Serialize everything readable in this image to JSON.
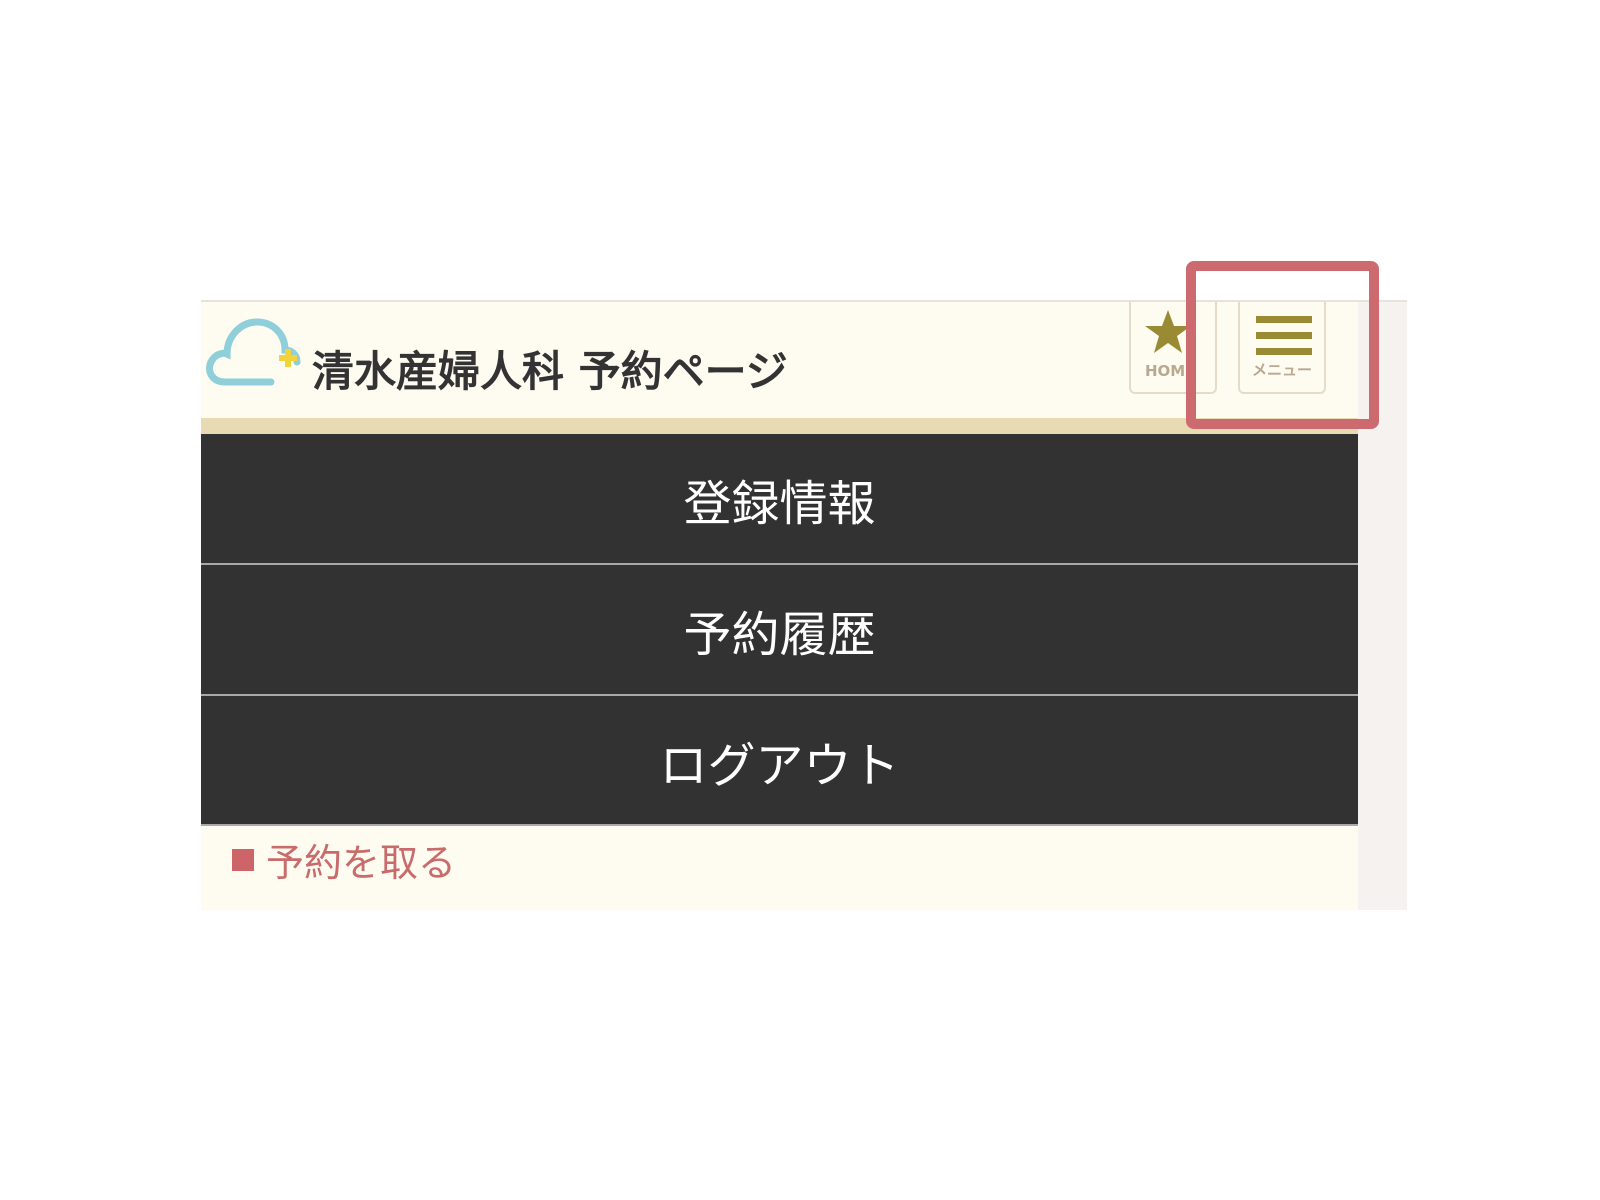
{
  "header": {
    "site_title": "清水産婦人科 予約ページ",
    "home_label": "HOME",
    "menu_label": "メニュー"
  },
  "menu": {
    "items": [
      {
        "label": "登録情報"
      },
      {
        "label": "予約履歴"
      },
      {
        "label": "ログアウト"
      }
    ]
  },
  "content": {
    "reserve_link": "予約を取る"
  },
  "icons": {
    "logo": "cloud-plus-icon",
    "home": "star-icon",
    "menu": "hamburger-icon",
    "bullet": "square-icon"
  },
  "colors": {
    "header_bg": "#fefbf1",
    "menu_bg": "#323232",
    "accent_gold": "#9a8a33",
    "highlight": "#cd6a70",
    "link": "#c96b6b",
    "logo_cloud": "#8fcfda",
    "logo_plus": "#f2d43a"
  }
}
